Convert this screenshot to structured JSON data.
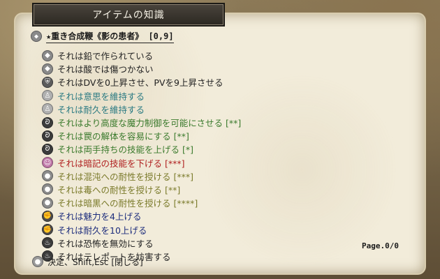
{
  "window": {
    "title": "アイテムの知識"
  },
  "item": {
    "name": "★重き合成鞭《影の患者》 [0,9]"
  },
  "colors": {
    "black": "#222222",
    "teal": "#2a7a82",
    "green": "#3a7a2c",
    "red": "#b02020",
    "olive": "#7a7a2a",
    "blue": "#1c2c7c"
  },
  "properties": [
    {
      "text": "それは鉛で作られている",
      "color": "black",
      "icon": "diamond-gray-icon"
    },
    {
      "text": "それは酸では傷つかない",
      "color": "black",
      "icon": "diamond-gray-icon"
    },
    {
      "text": "それはDVを0上昇させ、PVを9上昇させる",
      "color": "black",
      "icon": "shield-icon"
    },
    {
      "text": "それは意思を維持する",
      "color": "teal",
      "icon": "bell-icon"
    },
    {
      "text": "それは耐久を維持する",
      "color": "teal",
      "icon": "bell-icon"
    },
    {
      "text": "それはより高度な魔力制御を可能にさせる [**]",
      "color": "green",
      "icon": "swirl-icon"
    },
    {
      "text": "それは罠の解体を容易にする [**]",
      "color": "green",
      "icon": "swirl-icon"
    },
    {
      "text": "それは両手持ちの技能を上げる [*]",
      "color": "green",
      "icon": "swirl-icon"
    },
    {
      "text": "それは暗記の技能を下げる [***]",
      "color": "red",
      "icon": "face-pink-icon"
    },
    {
      "text": "それは混沌への耐性を授ける [***]",
      "color": "olive",
      "icon": "orb-gray-icon"
    },
    {
      "text": "それは毒への耐性を授ける [**]",
      "color": "olive",
      "icon": "orb-gray-icon"
    },
    {
      "text": "それは暗黒への耐性を授ける [****]",
      "color": "olive",
      "icon": "orb-gray-icon"
    },
    {
      "text": "それは魅力を4上げる",
      "color": "blue",
      "icon": "fist-icon"
    },
    {
      "text": "それは耐久を10上げる",
      "color": "blue",
      "icon": "fist-icon"
    },
    {
      "text": "それは恐怖を無効にする",
      "color": "black",
      "icon": "flame-icon"
    },
    {
      "text": "それはテレポートを妨害する",
      "color": "black",
      "icon": "flame-icon"
    }
  ],
  "page_indicator": "Page.0/0",
  "footer": {
    "hint": "決定、Shift,Esc [閉じる]"
  }
}
